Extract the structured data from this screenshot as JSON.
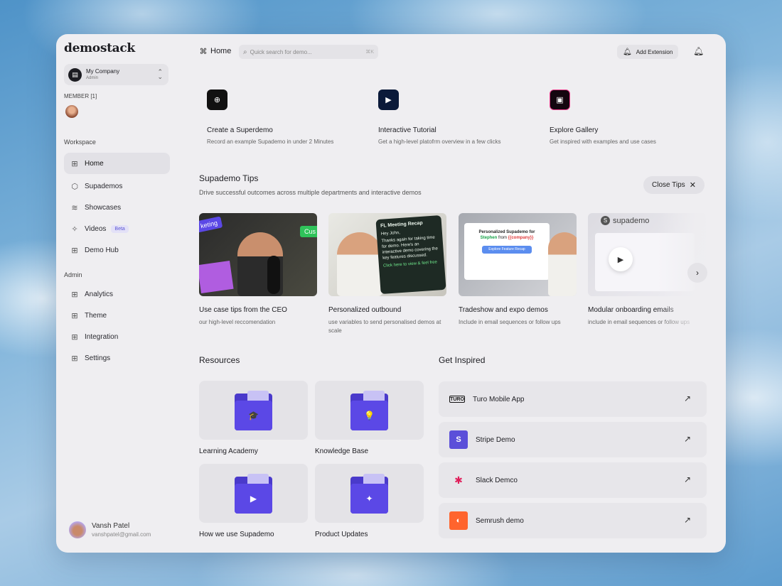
{
  "app": {
    "logo": "demostack"
  },
  "company": {
    "avatar_glyph": "▤",
    "name": "My Company",
    "role": "Admin"
  },
  "member_label": "MEMBER [1]",
  "sidebar": {
    "workspace_label": "Workspace",
    "workspace_items": [
      {
        "label": "Home",
        "icon": "home-grid-icon"
      },
      {
        "label": "Supademos",
        "icon": "cube-icon"
      },
      {
        "label": "Showcases",
        "icon": "layers-icon"
      },
      {
        "label": "Videos",
        "icon": "sparkle-icon",
        "badge": "Beta"
      },
      {
        "label": "Demo Hub",
        "icon": "grid-icon"
      }
    ],
    "admin_label": "Admin",
    "admin_items": [
      {
        "label": "Analytics",
        "icon": "grid-icon"
      },
      {
        "label": "Theme",
        "icon": "grid-icon"
      },
      {
        "label": "Integration",
        "icon": "grid-icon"
      },
      {
        "label": "Settings",
        "icon": "grid-icon"
      }
    ]
  },
  "user": {
    "name": "Vansh Patel",
    "email": "vanshpatel@gmail.com"
  },
  "topbar": {
    "title": "Home",
    "search_placeholder": "Quick search for demo...",
    "search_shortcut": "⌘K",
    "add_extension": "Add Extension"
  },
  "quick_actions": [
    {
      "title": "Create a Superdemo",
      "desc": "Record an example Supademo in under 2 Minutes",
      "icon": "folder-plus-icon"
    },
    {
      "title": "Interactive Tutorial",
      "desc": "Get a high-level platofrm overview in a few clicks",
      "icon": "screen-play-icon"
    },
    {
      "title": "Explore Gallery",
      "desc": "Get inspired with examples and use cases",
      "icon": "gallery-icon"
    }
  ],
  "tips": {
    "title": "Supademo Tips",
    "subtitle": "Drive successful outcomes across multiple departments and interactive demos",
    "close_label": "Close Tips",
    "cards": [
      {
        "title": "Use case tips from the CEO",
        "desc": "our high-level reccomendation"
      },
      {
        "title": "Personalized outbound",
        "desc": "use variables to send personalised demos at scale"
      },
      {
        "title": "Tradeshow and expo demos",
        "desc": "Include in email sequences or follow ups"
      },
      {
        "title": "Modular onboarding emails",
        "desc": "include in email sequences or follow ups"
      }
    ],
    "thumb1": {
      "bubble_a": "keting",
      "bubble_b": "Cus"
    },
    "thumb2": {
      "header": "FL Meeting Recap",
      "greeting": "Hey John,",
      "body": "Thanks again for taking time for demo. Here's an interactive demo covering the key features discussed.",
      "cta": "Click here to view & feel free"
    },
    "thumb3": {
      "line1": "Personalized Supademo for",
      "name": "Stephen",
      "from": "from",
      "company": "{{company}}",
      "button": "Explore Feature Recap"
    },
    "thumb4": {
      "brand": "supademo",
      "brand_glyph": "S"
    }
  },
  "resources": {
    "title": "Resources",
    "items": [
      {
        "label": "Learning Academy",
        "icon": "graduation-cap-icon",
        "glyph": "🎓"
      },
      {
        "label": "Knowledge Base",
        "icon": "lightbulb-icon",
        "glyph": "💡"
      },
      {
        "label": "How we use Supademo",
        "icon": "play-icon",
        "glyph": "▶"
      },
      {
        "label": "Product Updates",
        "icon": "sparkle-icon",
        "glyph": "✦"
      }
    ]
  },
  "inspired": {
    "title": "Get Inspired",
    "items": [
      {
        "label": "Turo Mobile App",
        "logo": "TURO"
      },
      {
        "label": "Stripe Demo",
        "logo": "S"
      },
      {
        "label": "Slack Demco",
        "logo": "✱"
      },
      {
        "label": "Semrush demo",
        "logo": "◐"
      }
    ]
  }
}
